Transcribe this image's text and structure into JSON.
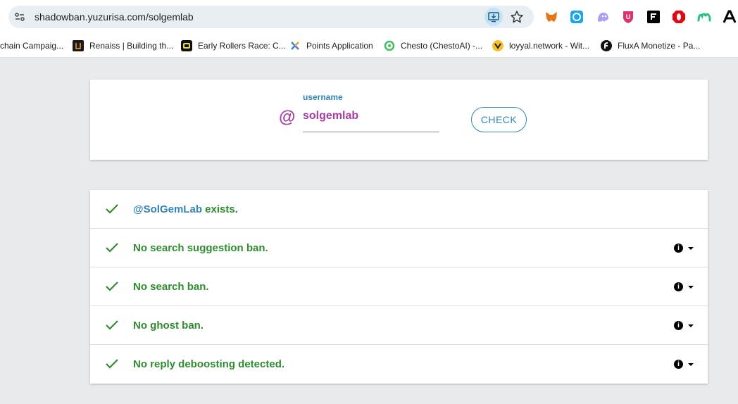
{
  "browser": {
    "url": "shadowban.yuzurisa.com/solgemlab",
    "extensions": [
      "metamask-icon",
      "refresh-extension-icon",
      "ghost-extension-icon",
      "u-shield-icon",
      "f-square-icon",
      "opera-red-icon",
      "green-m-icon",
      "black-a-icon"
    ],
    "bookmarks": [
      {
        "label": "chain Campaig...",
        "icon": ""
      },
      {
        "label": "Renaiss | Building th...",
        "icon": "renaiss-icon"
      },
      {
        "label": "Early Rollers Race: C...",
        "icon": "early-rollers-icon"
      },
      {
        "label": "Points Application",
        "icon": "points-icon"
      },
      {
        "label": "Chesto (ChestoAI) -...",
        "icon": "chesto-icon"
      },
      {
        "label": "loyyal.network - Wit...",
        "icon": "loyyal-icon"
      },
      {
        "label": "FluxA Monetize - Pa...",
        "icon": "fluxa-icon"
      }
    ]
  },
  "search": {
    "at_symbol": "@",
    "field_label": "username",
    "field_value": "solgemlab",
    "check_label": "CHECK"
  },
  "results": [
    {
      "handle": "@SolGemLab",
      "text": " exists.",
      "has_info": false
    },
    {
      "handle": "",
      "text": "No search suggestion ban.",
      "has_info": true
    },
    {
      "handle": "",
      "text": "No search ban.",
      "has_info": true
    },
    {
      "handle": "",
      "text": "No ghost ban.",
      "has_info": true
    },
    {
      "handle": "",
      "text": "No reply deboosting detected.",
      "has_info": true
    }
  ],
  "colors": {
    "success_green": "#2e8b2e",
    "link_blue": "#3385b7",
    "accent_purple": "#a53ea3",
    "page_bg": "#e8ebee"
  }
}
